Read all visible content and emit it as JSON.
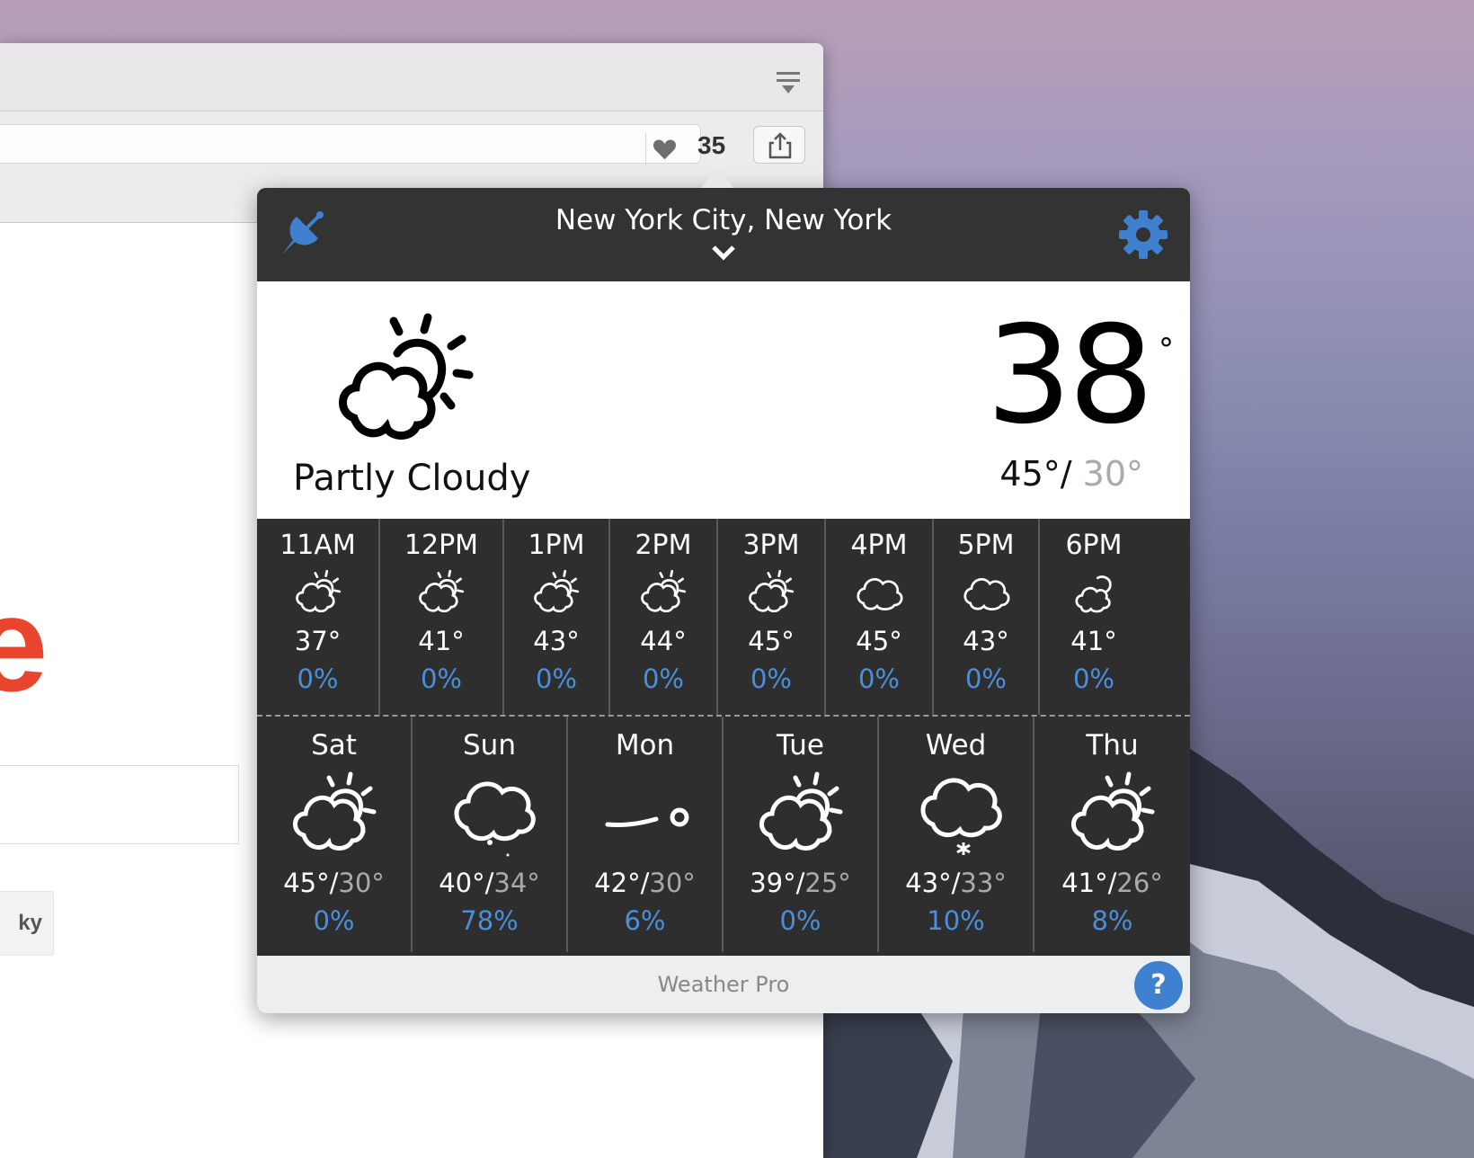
{
  "browser": {
    "counter": "35",
    "logo_fragment": "e",
    "lucky_button": "ky"
  },
  "weather": {
    "location": "New York City, New York",
    "current": {
      "condition": "Partly Cloudy",
      "temp": "38",
      "degree_symbol": "°",
      "high": "45°",
      "slash": "/ ",
      "low": "30°",
      "icon": "partly-cloudy-icon"
    },
    "hourly": [
      {
        "time": "11AM",
        "icon": "partly-cloudy-icon",
        "temp": "37°",
        "precip": "0%"
      },
      {
        "time": "12PM",
        "icon": "partly-cloudy-icon",
        "temp": "41°",
        "precip": "0%"
      },
      {
        "time": "1PM",
        "icon": "partly-cloudy-icon",
        "temp": "43°",
        "precip": "0%"
      },
      {
        "time": "2PM",
        "icon": "partly-cloudy-icon",
        "temp": "44°",
        "precip": "0%"
      },
      {
        "time": "3PM",
        "icon": "partly-cloudy-icon",
        "temp": "45°",
        "precip": "0%"
      },
      {
        "time": "4PM",
        "icon": "cloudy-icon",
        "temp": "45°",
        "precip": "0%"
      },
      {
        "time": "5PM",
        "icon": "cloudy-icon",
        "temp": "43°",
        "precip": "0%"
      },
      {
        "time": "6PM",
        "icon": "partly-cloudy-night-icon",
        "temp": "41°",
        "precip": "0%"
      }
    ],
    "daily": [
      {
        "day": "Sat",
        "icon": "partly-cloudy-icon",
        "high": "45°",
        "slash": "/",
        "low": "30°",
        "precip": "0%"
      },
      {
        "day": "Sun",
        "icon": "drizzle-icon",
        "high": "40°",
        "slash": "/",
        "low": "34°",
        "precip": "78%"
      },
      {
        "day": "Mon",
        "icon": "windy-icon",
        "high": "42°",
        "slash": "/",
        "low": "30°",
        "precip": "6%"
      },
      {
        "day": "Tue",
        "icon": "partly-cloudy-icon",
        "high": "39°",
        "slash": "/",
        "low": "25°",
        "precip": "0%"
      },
      {
        "day": "Wed",
        "icon": "snow-icon",
        "high": "43°",
        "slash": "/",
        "low": "33°",
        "precip": "10%"
      },
      {
        "day": "Thu",
        "icon": "partly-cloudy-icon",
        "high": "41°",
        "slash": "/",
        "low": "26°",
        "precip": "8%"
      }
    ],
    "footer": "Weather Pro",
    "help_label": "?"
  },
  "colors": {
    "accent_blue": "#3f80cf",
    "precip_blue": "#4b8fdc",
    "panel_dark": "#2e2e2e",
    "low_temp_gray": "#aaaaaa"
  }
}
